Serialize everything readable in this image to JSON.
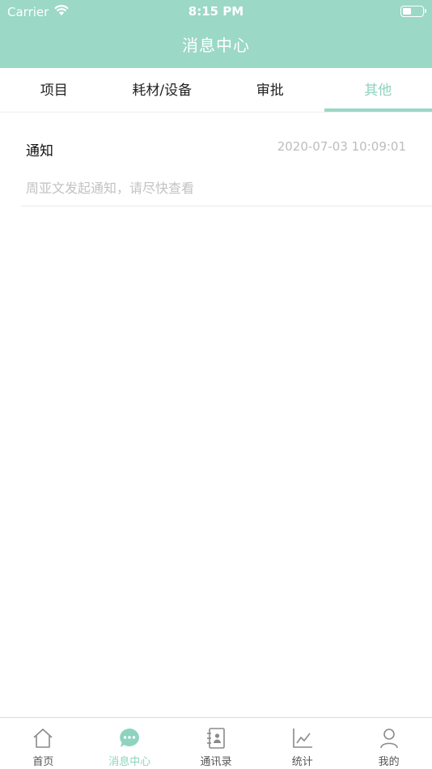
{
  "status_bar": {
    "carrier": "Carrier",
    "time": "8:15 PM",
    "battery_level": 0.45
  },
  "nav": {
    "title": "消息中心"
  },
  "tabs": [
    {
      "label": "项目",
      "active": false
    },
    {
      "label": "耗材/设备",
      "active": false
    },
    {
      "label": "审批",
      "active": false
    },
    {
      "label": "其他",
      "active": true
    }
  ],
  "messages": [
    {
      "title": "通知",
      "time": "2020-07-03 10:09:01",
      "body": "周亚文发起通知，请尽快查看"
    }
  ],
  "tabbar": [
    {
      "label": "首页",
      "icon": "home-icon"
    },
    {
      "label": "消息中心",
      "icon": "chat-bubble-icon",
      "active": true
    },
    {
      "label": "通讯录",
      "icon": "contacts-book-icon"
    },
    {
      "label": "统计",
      "icon": "line-chart-icon"
    },
    {
      "label": "我的",
      "icon": "user-icon"
    }
  ],
  "colors": {
    "accent": "#9bd8c6",
    "accent_text": "#8ed3bf",
    "muted": "#c2c2c2"
  }
}
